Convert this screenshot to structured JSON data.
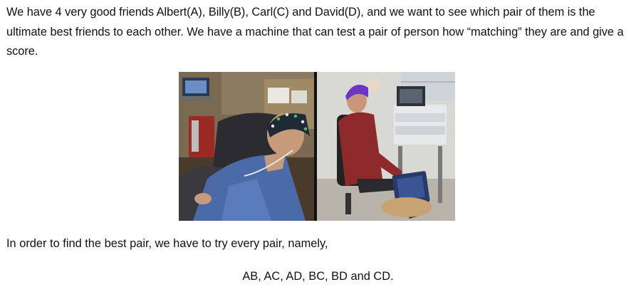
{
  "document": {
    "intro_paragraph": "We have 4 very good friends Albert(A), Billy(B), Carl(C) and David(D), and we want to see which pair of them is the ultimate best friends to each other. We have a machine that can test a pair of person how “matching” they are and give a score.",
    "instruction_line": "In order to find the best pair, we have to try every pair, namely,",
    "pairs_line": "AB, AC, AD, BC, BD and CD."
  }
}
